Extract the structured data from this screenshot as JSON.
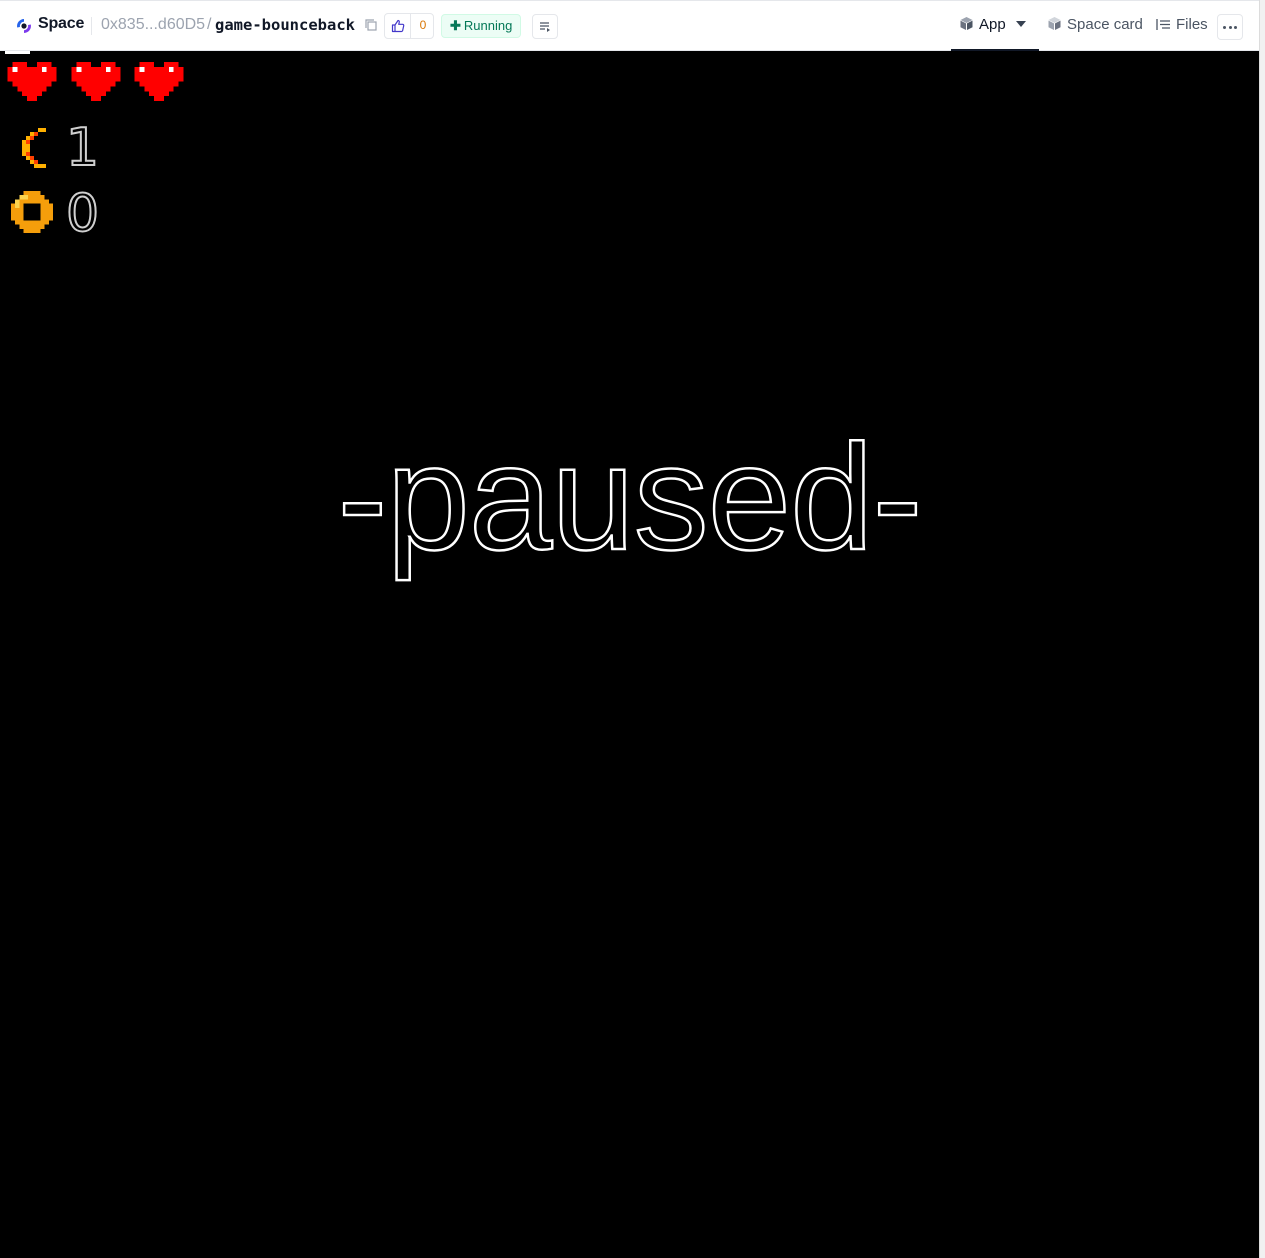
{
  "header": {
    "brand": "Space",
    "owner": "0x835...d60D5",
    "separator": "/",
    "repo_name": "game-bounceback",
    "like_count": "0",
    "status": "Running",
    "tabs": [
      {
        "label": "App",
        "icon": "cube-icon",
        "active": true
      },
      {
        "label": "Space card",
        "icon": "cube-icon",
        "active": false
      },
      {
        "label": "Files",
        "icon": "files-icon",
        "active": false
      }
    ]
  },
  "game": {
    "lives": 3,
    "boomerang_count": "1",
    "coin_count": "0",
    "paused_text": "-paused-",
    "colors": {
      "background": "#000000",
      "heart": "#ff0000",
      "coin": "#f59e0b",
      "boomerang": "#ffb000"
    }
  }
}
